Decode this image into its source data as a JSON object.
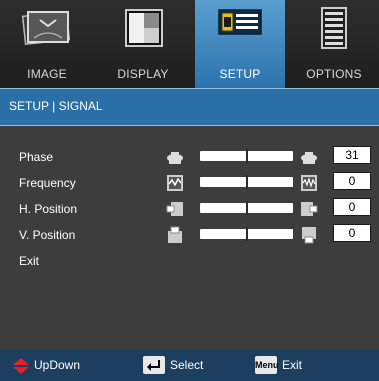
{
  "tabs": [
    {
      "label": "IMAGE",
      "icon": "image-icon",
      "active": false
    },
    {
      "label": "DISPLAY",
      "icon": "display-icon",
      "active": false
    },
    {
      "label": "SETUP",
      "icon": "setup-icon",
      "active": true
    },
    {
      "label": "OPTIONS",
      "icon": "options-icon",
      "active": false
    }
  ],
  "section_title": "SETUP | SIGNAL",
  "rows": [
    {
      "label": "Phase",
      "value": "31",
      "icon": "phase-icon"
    },
    {
      "label": "Frequency",
      "value": "0",
      "icon": "frequency-icon"
    },
    {
      "label": "H. Position",
      "value": "0",
      "icon": "h-position-icon"
    },
    {
      "label": "V. Position",
      "value": "0",
      "icon": "v-position-icon"
    },
    {
      "label": "Exit"
    }
  ],
  "footer": {
    "updown": "UpDown",
    "select": "Select",
    "menu_key": "Menu",
    "exit": "Exit"
  },
  "colors": {
    "active_tab": "#3f8ac4",
    "title_bar": "#2a6fa6",
    "footer_bar": "#1c3f60",
    "updown_arrow": "#e8202a"
  }
}
